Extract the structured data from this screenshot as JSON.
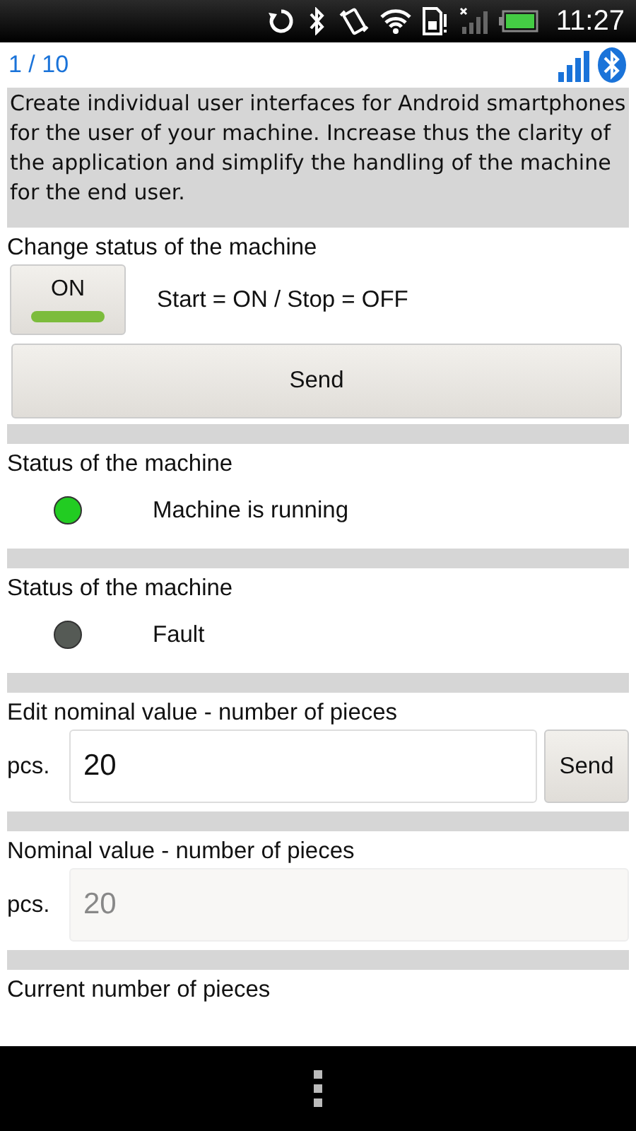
{
  "status_bar": {
    "time": "11:27"
  },
  "header": {
    "page": "1 / 10"
  },
  "description": "Create individual user interfaces for Android smartphones for the user of your machine. Increase thus the clarity of the application and simplify the handling of the machine for the end user.",
  "sections": [
    {
      "kind": "toggle",
      "title": "Change status of the machine",
      "toggle": {
        "label": "ON",
        "on": true
      },
      "hint": "Start = ON / Stop = OFF",
      "button": "Send"
    },
    {
      "kind": "lamp",
      "title": "Status of the machine",
      "color": "#22cc22",
      "text": "Machine is running"
    },
    {
      "kind": "lamp",
      "title": "Status of the machine",
      "color": "#555a55",
      "text": "Fault"
    },
    {
      "kind": "input",
      "title": "Edit nominal value - number of pieces",
      "unit": "pcs.",
      "value": "20",
      "disabled": false,
      "button": "Send"
    },
    {
      "kind": "input",
      "title": "Nominal value - number of pieces",
      "unit": "pcs.",
      "value": "20",
      "disabled": true
    },
    {
      "kind": "label",
      "title": "Current number of pieces"
    }
  ]
}
